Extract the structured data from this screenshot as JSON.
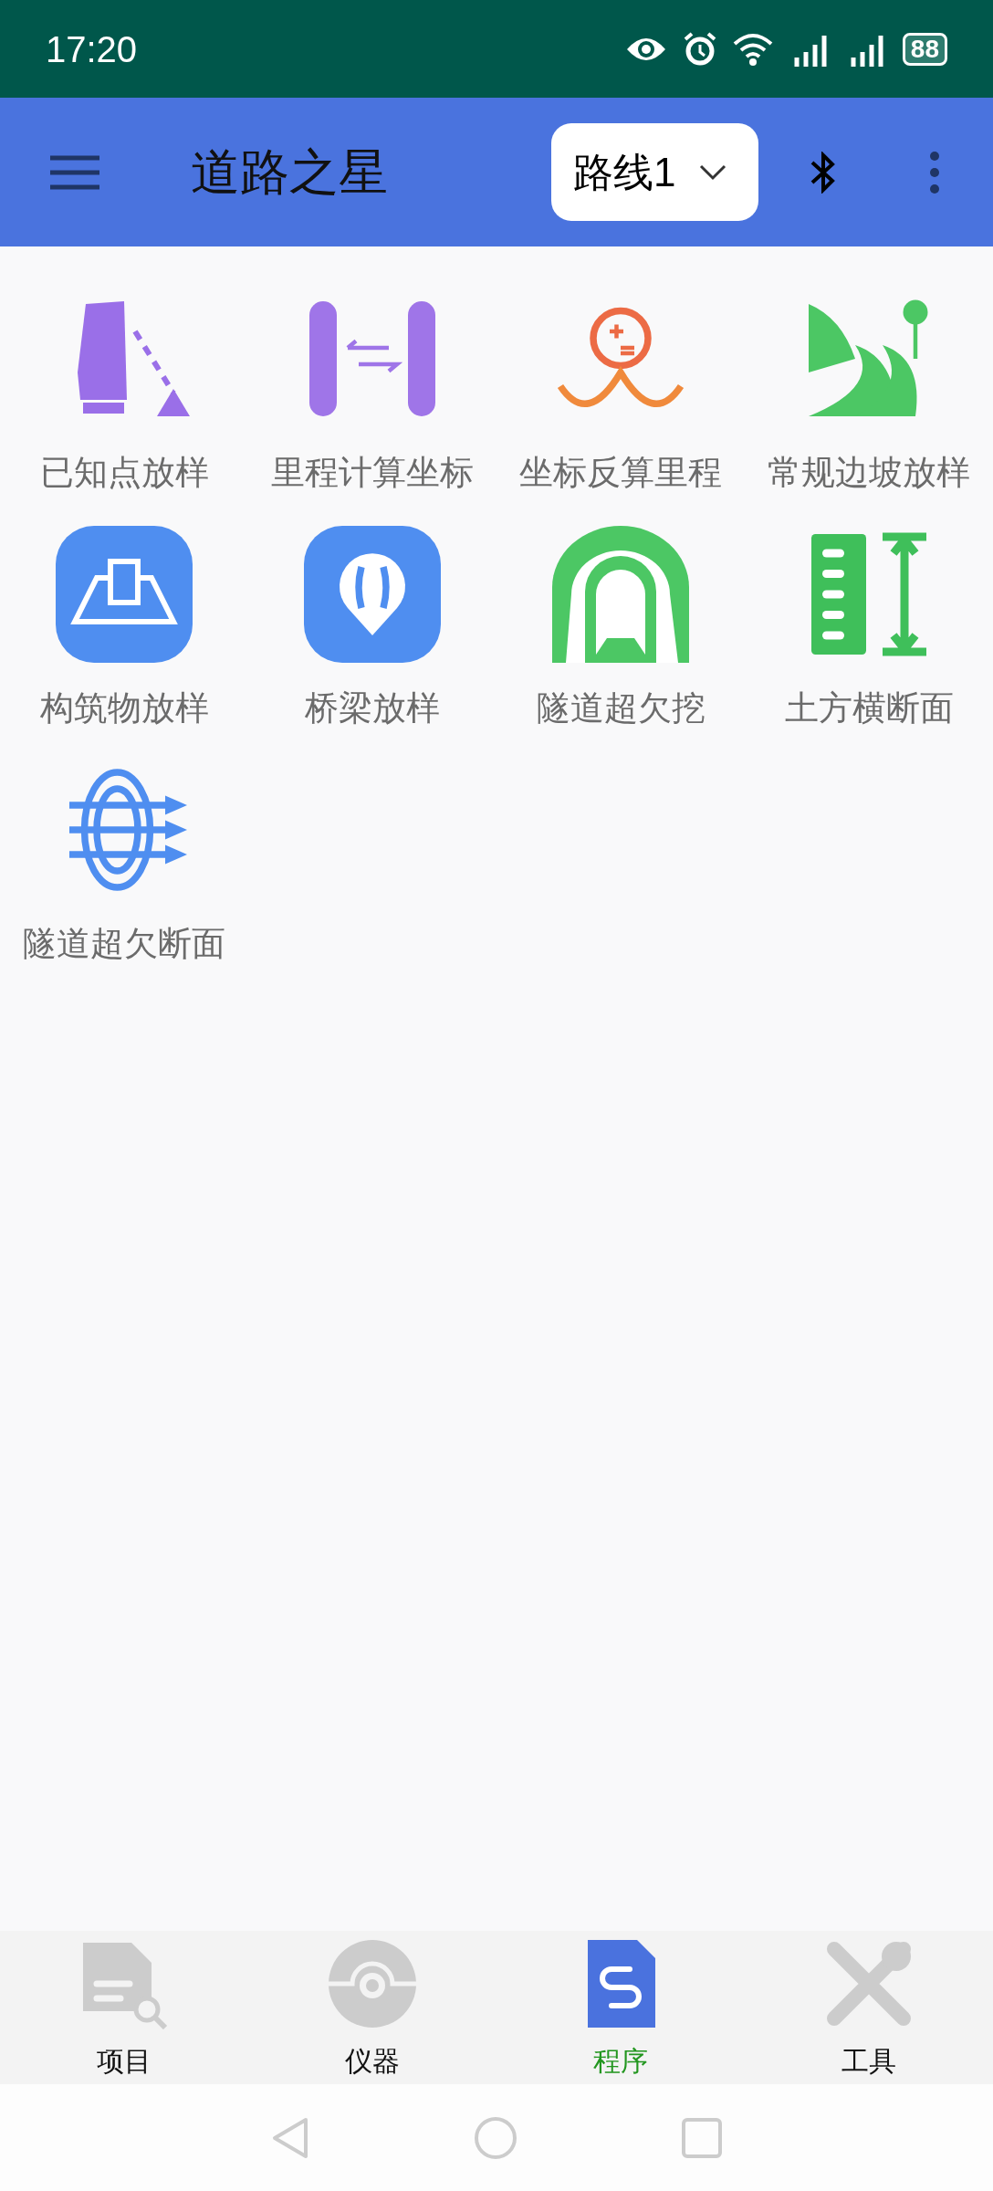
{
  "status_bar": {
    "time": "17:20",
    "battery": "88"
  },
  "app_bar": {
    "title": "道路之星",
    "route_select": "路线1"
  },
  "programs": [
    {
      "label": "已知点放样",
      "kind": "station"
    },
    {
      "label": "里程计算坐标",
      "kind": "mileage"
    },
    {
      "label": "坐标反算里程",
      "kind": "inverse"
    },
    {
      "label": "常规边坡放样",
      "kind": "slope"
    },
    {
      "label": "构筑物放样",
      "kind": "structure"
    },
    {
      "label": "桥梁放样",
      "kind": "bridge"
    },
    {
      "label": "隧道超欠挖",
      "kind": "tunnel"
    },
    {
      "label": "土方横断面",
      "kind": "earthwork"
    },
    {
      "label": "隧道超欠断面",
      "kind": "section"
    }
  ],
  "bottom_nav": [
    {
      "label": "项目",
      "kind": "project",
      "selected": false
    },
    {
      "label": "仪器",
      "kind": "instrument",
      "selected": false
    },
    {
      "label": "程序",
      "kind": "program",
      "selected": true
    },
    {
      "label": "工具",
      "kind": "tools",
      "selected": false
    }
  ]
}
